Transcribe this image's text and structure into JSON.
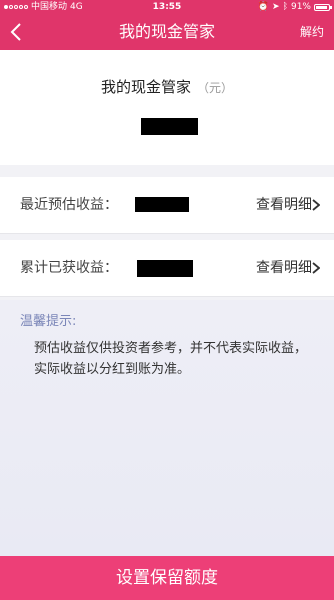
{
  "status_bar": {
    "carrier": "中国移动",
    "network": "4G",
    "time": "13:55",
    "battery_percent": "91%",
    "battery_level": 0.91
  },
  "nav": {
    "title": "我的现金管家",
    "action": "解约"
  },
  "summary": {
    "title": "我的现金管家",
    "unit": "（元）"
  },
  "rows": [
    {
      "label": "最近预估收益：",
      "link": "查看明细"
    },
    {
      "label": "累计已获收益：",
      "link": "查看明细"
    }
  ],
  "tips": {
    "title": "温馨提示:",
    "body": "预估收益仅供投资者参考，并不代表实际收益，实际收益以分红到账为准。"
  },
  "bottom_button": "设置保留额度",
  "colors": {
    "header_bg": "#e0356a",
    "button_bg": "#ed3f77",
    "tips_title": "#7b86b8"
  },
  "icons": {
    "back": "chevron-left-icon",
    "row_arrow": "chevron-right-icon",
    "alarm": "alarm-icon",
    "location": "location-arrow-icon",
    "bluetooth": "bluetooth-icon",
    "battery": "battery-icon"
  }
}
